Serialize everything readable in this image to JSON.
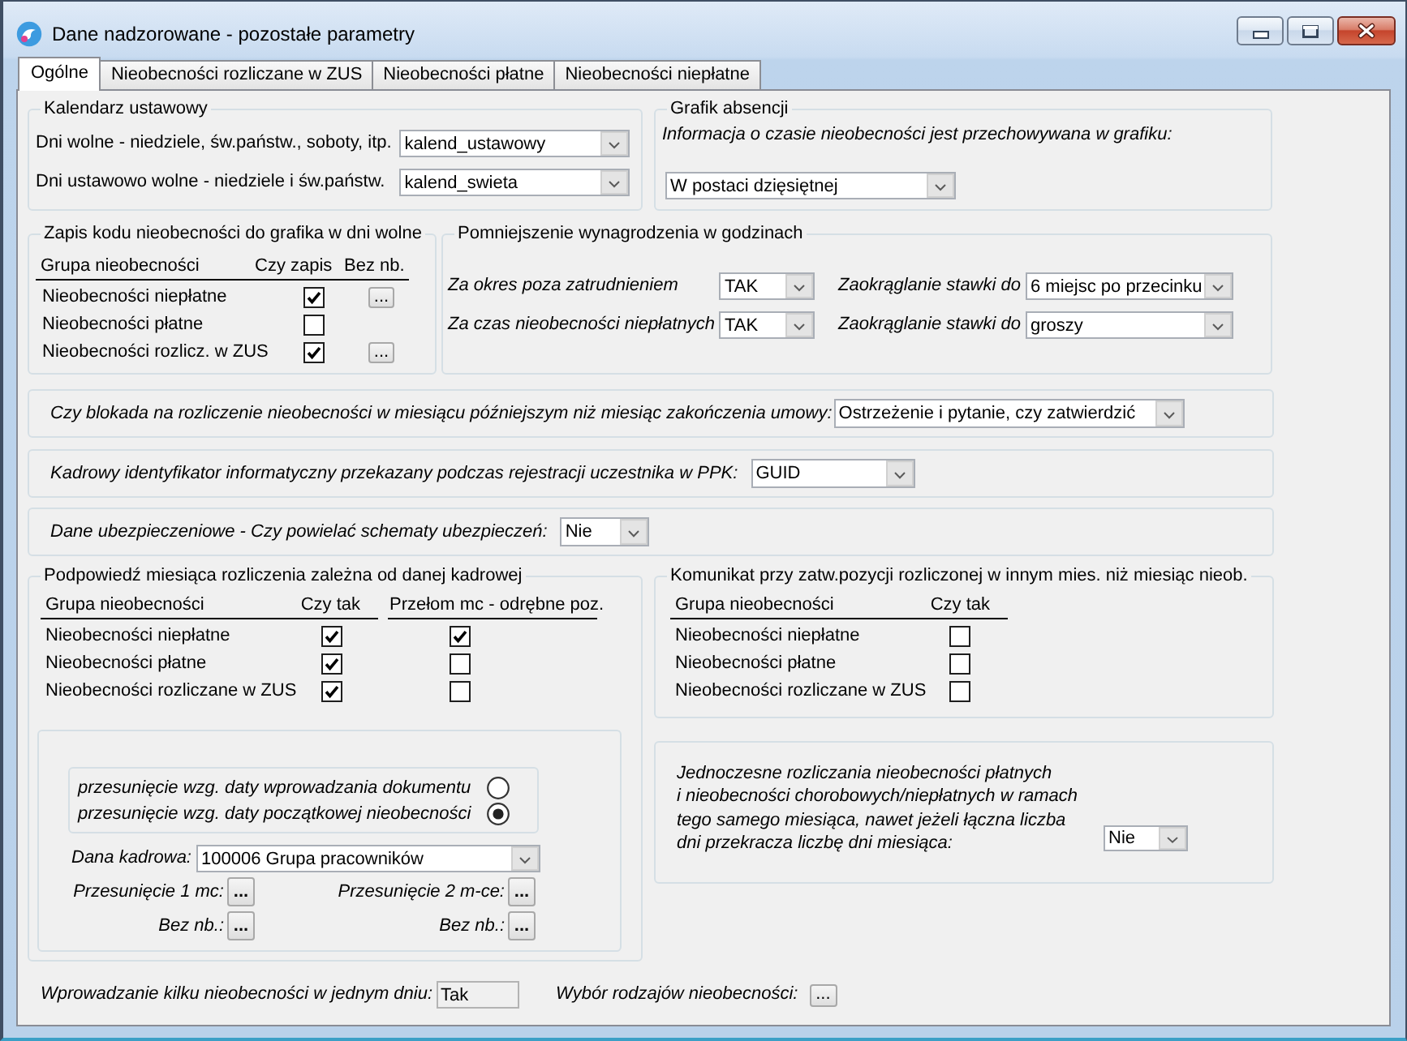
{
  "window": {
    "title": "Dane nadzorowane - pozostałe parametry"
  },
  "tabs": [
    {
      "label": "Ogólne",
      "selected": true
    },
    {
      "label": "Nieobecności rozliczane w ZUS",
      "selected": false
    },
    {
      "label": "Nieobecności płatne",
      "selected": false
    },
    {
      "label": "Nieobecności niepłatne",
      "selected": false
    }
  ],
  "kalendarz_ustawowy": {
    "title": "Kalendarz ustawowy",
    "rows": [
      {
        "label": "Dni wolne - niedziele, św.państw., soboty, itp.",
        "value": "kalend_ustawowy"
      },
      {
        "label": "Dni ustawowo wolne - niedziele i św.państw.",
        "value": "kalend_swieta"
      }
    ]
  },
  "grafik_absencji": {
    "title": "Grafik absencji",
    "label": "Informacja o czasie nieobecności jest przechowywana w grafiku:",
    "value": "W postaci dzięsiętnej"
  },
  "zapis_kodu": {
    "title": "Zapis kodu nieobecności do grafika w dni wolne",
    "columns": [
      "Grupa nieobecności",
      "Czy zapis",
      "Bez nb."
    ],
    "rows": [
      {
        "label": "Nieobecności niepłatne",
        "checked": true,
        "button": "..."
      },
      {
        "label": "Nieobecności płatne",
        "checked": false
      },
      {
        "label": "Nieobecności rozlicz. w ZUS",
        "checked": true,
        "button": "..."
      }
    ]
  },
  "pomniejszenie": {
    "title": "Pomniejszenie wynagrodzenia w godzinach",
    "rows": [
      {
        "label": "Za okres poza zatrudnieniem",
        "value": "TAK",
        "rounding_label": "Zaokrąglanie stawki do",
        "rounding_value": "6 miejsc po przecinku"
      },
      {
        "label": "Za czas nieobecności niepłatnych",
        "value": "TAK",
        "rounding_label": "Zaokrąglanie stawki do",
        "rounding_value": "groszy"
      }
    ]
  },
  "settings": [
    {
      "label": "Czy blokada na rozliczenie nieobecności w miesiącu późniejszym niż miesiąc zakończenia umowy:",
      "value": "Ostrzeżenie i pytanie, czy zatwierdzić"
    },
    {
      "label": "Kadrowy identyfikator informatyczny przekazany podczas rejestracji uczestnika w PPK:",
      "value": "GUID"
    },
    {
      "label": "Dane ubezpieczeniowe - Czy powielać schematy ubezpieczeń:",
      "value": "Nie"
    }
  ],
  "podpowiedz": {
    "title": "Podpowiedź miesiąca rozliczenia zależna od danej kadrowej",
    "columns": [
      "Grupa nieobecności",
      "Czy tak",
      "Przełom mc - odrębne poz."
    ],
    "rows": [
      {
        "label": "Nieobecności niepłatne",
        "czy_tak": true,
        "przelom": true
      },
      {
        "label": "Nieobecności płatne",
        "czy_tak": true,
        "przelom": false
      },
      {
        "label": "Nieobecności rozliczane w ZUS",
        "czy_tak": true,
        "przelom": false
      }
    ],
    "shift_options": [
      {
        "label": "przesunięcie wzg. daty wprowadzania dokumentu",
        "selected": false
      },
      {
        "label": "przesunięcie wzg. daty początkowej nieobecności",
        "selected": true
      }
    ],
    "dana_kadrowa": {
      "label": "Dana kadrowa:",
      "value": "100006 Grupa pracowników"
    },
    "shift_buttons": [
      {
        "label": "Przesunięcie 1 mc:",
        "button": "..."
      },
      {
        "label": "Przesunięcie 2 m-ce:",
        "button": "..."
      },
      {
        "label": "Bez nb.:",
        "button": "..."
      },
      {
        "label": "Bez nb.:",
        "button": "..."
      }
    ]
  },
  "komunikat": {
    "title": "Komunikat przy zatw.pozycji rozliczonej w innym mies. niż miesiąc nieob.",
    "columns": [
      "Grupa nieobecności",
      "Czy tak"
    ],
    "rows": [
      {
        "label": "Nieobecności niepłatne",
        "checked": false
      },
      {
        "label": "Nieobecności płatne",
        "checked": false
      },
      {
        "label": "Nieobecności rozliczane w ZUS",
        "checked": false
      }
    ]
  },
  "jednoczesne": {
    "text": "Jednoczesne rozliczania nieobecności płatnych\ni nieobecności chorobowych/niepłatnych w ramach\ntego samego miesiąca, nawet jeżeli łączna liczba\ndni przekracza liczbę dni miesiąca:",
    "value": "Nie"
  },
  "bottom": {
    "multi_label": "Wprowadzanie kilku nieobecności w jednym dniu:",
    "multi_value": "Tak",
    "multi_read_only": true,
    "types_label": "Wybór rodzajów nieobecności:",
    "types_button": "..."
  }
}
